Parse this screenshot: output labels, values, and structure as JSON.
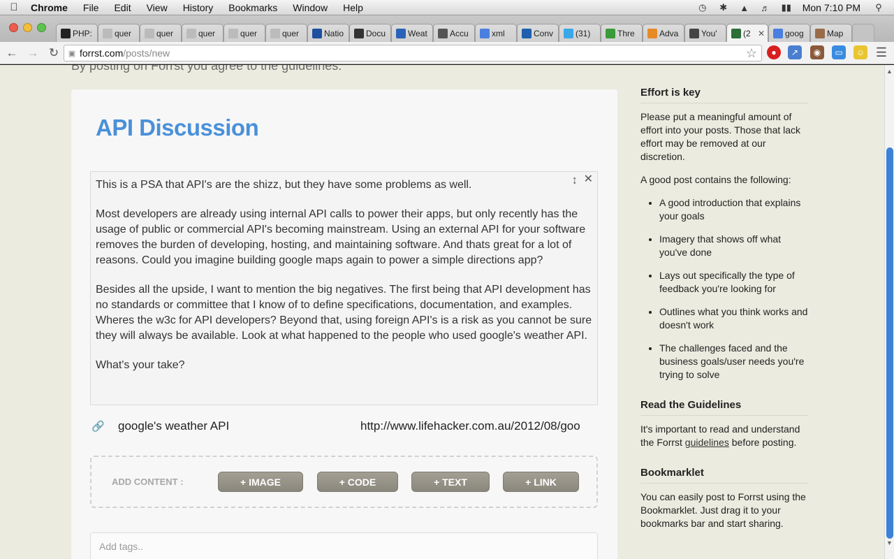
{
  "menubar": {
    "app": "Chrome",
    "items": [
      "File",
      "Edit",
      "View",
      "History",
      "Bookmarks",
      "Window",
      "Help"
    ],
    "clock": "Mon 7:10 PM"
  },
  "tabs": [
    {
      "label": "PHP:",
      "icon": "check-favicon",
      "color": "#222222"
    },
    {
      "label": "quer",
      "icon": "page-favicon",
      "color": "#bbbbbb"
    },
    {
      "label": "quer",
      "icon": "page-favicon",
      "color": "#bbbbbb"
    },
    {
      "label": "quer",
      "icon": "page-favicon",
      "color": "#bbbbbb"
    },
    {
      "label": "quer",
      "icon": "page-favicon",
      "color": "#bbbbbb"
    },
    {
      "label": "quer",
      "icon": "page-favicon",
      "color": "#bbbbbb"
    },
    {
      "label": "Natio",
      "icon": "noaa-favicon",
      "color": "#1f4fa0"
    },
    {
      "label": "Docu",
      "icon": "docu-favicon",
      "color": "#333333"
    },
    {
      "label": "Weat",
      "icon": "weather-favicon",
      "color": "#2a62b8"
    },
    {
      "label": "Accu",
      "icon": "accu-favicon",
      "color": "#555555"
    },
    {
      "label": "xml",
      "icon": "google-favicon",
      "color": "#4a7fe0"
    },
    {
      "label": "Conv",
      "icon": "ibm-favicon",
      "color": "#1f5fae"
    },
    {
      "label": "(31)",
      "icon": "twitter-favicon",
      "color": "#39a7e8"
    },
    {
      "label": "Thre",
      "icon": "eye-favicon",
      "color": "#3a9b3a"
    },
    {
      "label": "Adva",
      "icon": "u-favicon",
      "color": "#e58a24"
    },
    {
      "label": "You'",
      "icon": "tools-favicon",
      "color": "#444444"
    },
    {
      "label": "(2",
      "icon": "forrst-favicon",
      "color": "#2b6e37",
      "active": true
    },
    {
      "label": "goog",
      "icon": "google-favicon",
      "color": "#4a7fe0"
    },
    {
      "label": "Map",
      "icon": "avatar-favicon",
      "color": "#9a6b4a"
    }
  ],
  "omnibox": {
    "host": "forrst.com",
    "path": "/posts/new"
  },
  "page": {
    "agree_text": "By posting on Forrst you agree to the guidelines.",
    "title": "API Discussion",
    "body_paragraphs": [
      "This is a PSA that API's are the shizz, but they have some problems as well.",
      "Most developers are already using internal API calls to power their apps, but only recently has the usage of public or commercial API's becoming mainstream. Using an external API for your software removes the burden of developing, hosting, and maintaining software. And thats great for a lot of reasons. Could you imagine building google maps again to power a simple directions app?",
      "Besides all the upside, I want to mention the big negatives. The first being that API development has no standards or committee that I know of to define specifications, documentation, and examples. Wheres the w3c for API developers? Beyond that, using foreign API's is a risk as you cannot be sure they will always be available. Look at what happened to the people who used google's weather API.",
      "What's your take?"
    ],
    "link": {
      "title": "google's weather API",
      "url": "http://www.lifehacker.com.au/2012/08/goo"
    },
    "add_content": {
      "label": "ADD CONTENT :",
      "buttons": [
        "+ IMAGE",
        "+ CODE",
        "+ TEXT",
        "+ LINK"
      ]
    },
    "tags_placeholder": "Add tags.."
  },
  "sidebar": {
    "effort": {
      "heading": "Effort is key",
      "intro": "Please put a meaningful amount of effort into your posts. Those that lack effort may be removed at our discretion.",
      "list_intro": "A good post contains the following:",
      "items": [
        "A good introduction that explains your goals",
        "Imagery that shows off what you've done",
        "Lays out specifically the type of feedback you're looking for",
        "Outlines what you think works and doesn't work",
        "The challenges faced and the business goals/user needs you're trying to solve"
      ]
    },
    "guidelines": {
      "heading": "Read the Guidelines",
      "text_before": "It's important to read and understand the Forrst ",
      "link": "guidelines",
      "text_after": " before posting."
    },
    "bookmarklet": {
      "heading": "Bookmarklet",
      "text": "You can easily post to Forrst using the Bookmarklet. Just drag it to your bookmarks bar and start sharing."
    }
  },
  "colors": {
    "title_blue": "#4a90d9",
    "page_bg": "#ecebdf",
    "button_grey": "#8f8c81",
    "scroll_blue": "#3b82d6"
  }
}
